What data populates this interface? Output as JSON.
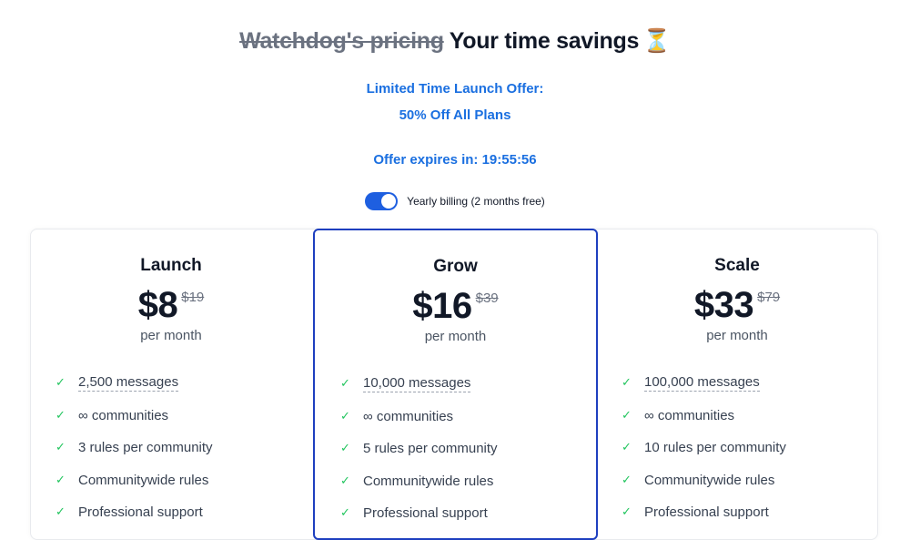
{
  "header": {
    "title_old": "Watchdog's pricing",
    "title_new": "Your time savings",
    "title_icon": "⏳"
  },
  "offer": {
    "line1": "Limited Time Launch Offer:",
    "line2": "50% Off All Plans",
    "countdown": "Offer expires in: 19:55:56"
  },
  "billing": {
    "label": "Yearly billing (2 months free)",
    "enabled": true,
    "color": "#1e5fe0"
  },
  "colors": {
    "accent_blue": "#1a6fe0",
    "highlight_border": "#1e3fbf",
    "check_green": "#22c55e"
  },
  "plans": [
    {
      "name": "Launch",
      "price": "$8",
      "old_price": "$19",
      "period": "per month",
      "features": [
        "2,500 messages",
        "∞ communities",
        "3 rules per community",
        "Communitywide rules",
        "Professional support"
      ]
    },
    {
      "name": "Grow",
      "price": "$16",
      "old_price": "$39",
      "period": "per month",
      "features": [
        "10,000 messages",
        "∞ communities",
        "5 rules per community",
        "Communitywide rules",
        "Professional support"
      ]
    },
    {
      "name": "Scale",
      "price": "$33",
      "old_price": "$79",
      "period": "per month",
      "features": [
        "100,000 messages",
        "∞ communities",
        "10 rules per community",
        "Communitywide rules",
        "Professional support"
      ]
    }
  ]
}
